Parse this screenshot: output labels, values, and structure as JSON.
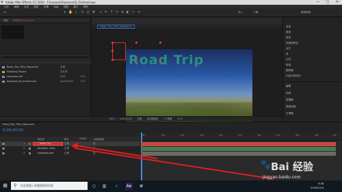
{
  "window": {
    "title": "Adobe After Effects CC 2019 - F:\\Lesson03\\Lesson03_Finished.aep",
    "controls": {
      "minimize": "—",
      "maximize": "□",
      "close": "✕"
    }
  },
  "menu": [
    "文件",
    "编辑",
    "合成",
    "图层",
    "效果",
    "动画",
    "视图",
    "窗口",
    "帮助"
  ],
  "toolbar": {
    "tools": [
      "home-icon",
      "select-icon",
      "hand-icon",
      "zoom-icon",
      "rotate-icon",
      "camera-icon",
      "pan-icon",
      "rect-icon",
      "pen-icon",
      "type-icon",
      "brush-icon",
      "clone-icon",
      "eraser-icon",
      "roto-icon",
      "puppet-icon"
    ],
    "right_label": "默认",
    "right_label2": "了解",
    "search_placeholder": "搜索帮助"
  },
  "project": {
    "tabs": [
      "项目",
      "效果控件 Road Trip"
    ],
    "search_placeholder": "",
    "items": [
      {
        "name": "Road_Trip_Title_Sequence",
        "type": "合成",
        "size": "",
        "color": "#8a8ed0"
      },
      {
        "name": "Finished_Project",
        "type": "文件夹",
        "size": "",
        "color": "#c9a33b"
      },
      {
        "name": "compass.swf",
        "type": "SWF",
        "size": "0 B",
        "color": "#8a8a8a"
      },
      {
        "name": "background_movie.mov",
        "type": "QuickTime",
        "size": "5 B",
        "color": "#6aa66a"
      }
    ]
  },
  "viewer": {
    "tab_label": "Road_Trip_Title_Sequence",
    "title_text": "Road Trip",
    "controls": [
      "50%",
      "0;00;00;00",
      "完整",
      "活动摄像机",
      "1个视图",
      "+0.0"
    ]
  },
  "right_panel": {
    "items": [
      "信息",
      "音频",
      "预览",
      "效果和预设",
      "对齐",
      "库",
      "字符",
      "段落",
      "跟踪器",
      "内容识别填充",
      "画笔",
      "绘画",
      "摇摆器",
      "蒙版插值",
      "平滑器"
    ],
    "header_label": "跟踪器"
  },
  "timeline": {
    "tab_label": "Road_Trip_Title_Sequence",
    "time": "0;00;00;00",
    "columns": {
      "source": "源名称",
      "mode": "模式",
      "trkmat": "TrkMat",
      "parent": "父级和链接"
    },
    "layers": [
      {
        "num": "1",
        "name": "Road Trip",
        "mode": "正常",
        "parent": "无",
        "color": "#d04040",
        "bar_color": "#c44848"
      },
      {
        "num": "2",
        "name": "backgro...mov",
        "mode": "正常",
        "parent": "无",
        "color": "#6aa66a",
        "bar_color": "#4e7a4e"
      },
      {
        "num": "3",
        "name": "compass.swf",
        "mode": "正常",
        "parent": "无",
        "color": "#8a8a8a",
        "bar_color": "#6a6a6a"
      }
    ],
    "ruler": [
      "0s",
      "01s",
      "02s",
      "03s",
      "04s",
      "05s",
      "06s",
      "07s",
      "08s",
      "09s",
      "10s"
    ]
  },
  "taskbar": {
    "search_placeholder": "在这里输入你要搜索的内容",
    "time": "9:38",
    "date": "2018/11/4"
  },
  "watermark": {
    "logo": "Bai 经验",
    "url": "jingyan.baidu.com"
  }
}
